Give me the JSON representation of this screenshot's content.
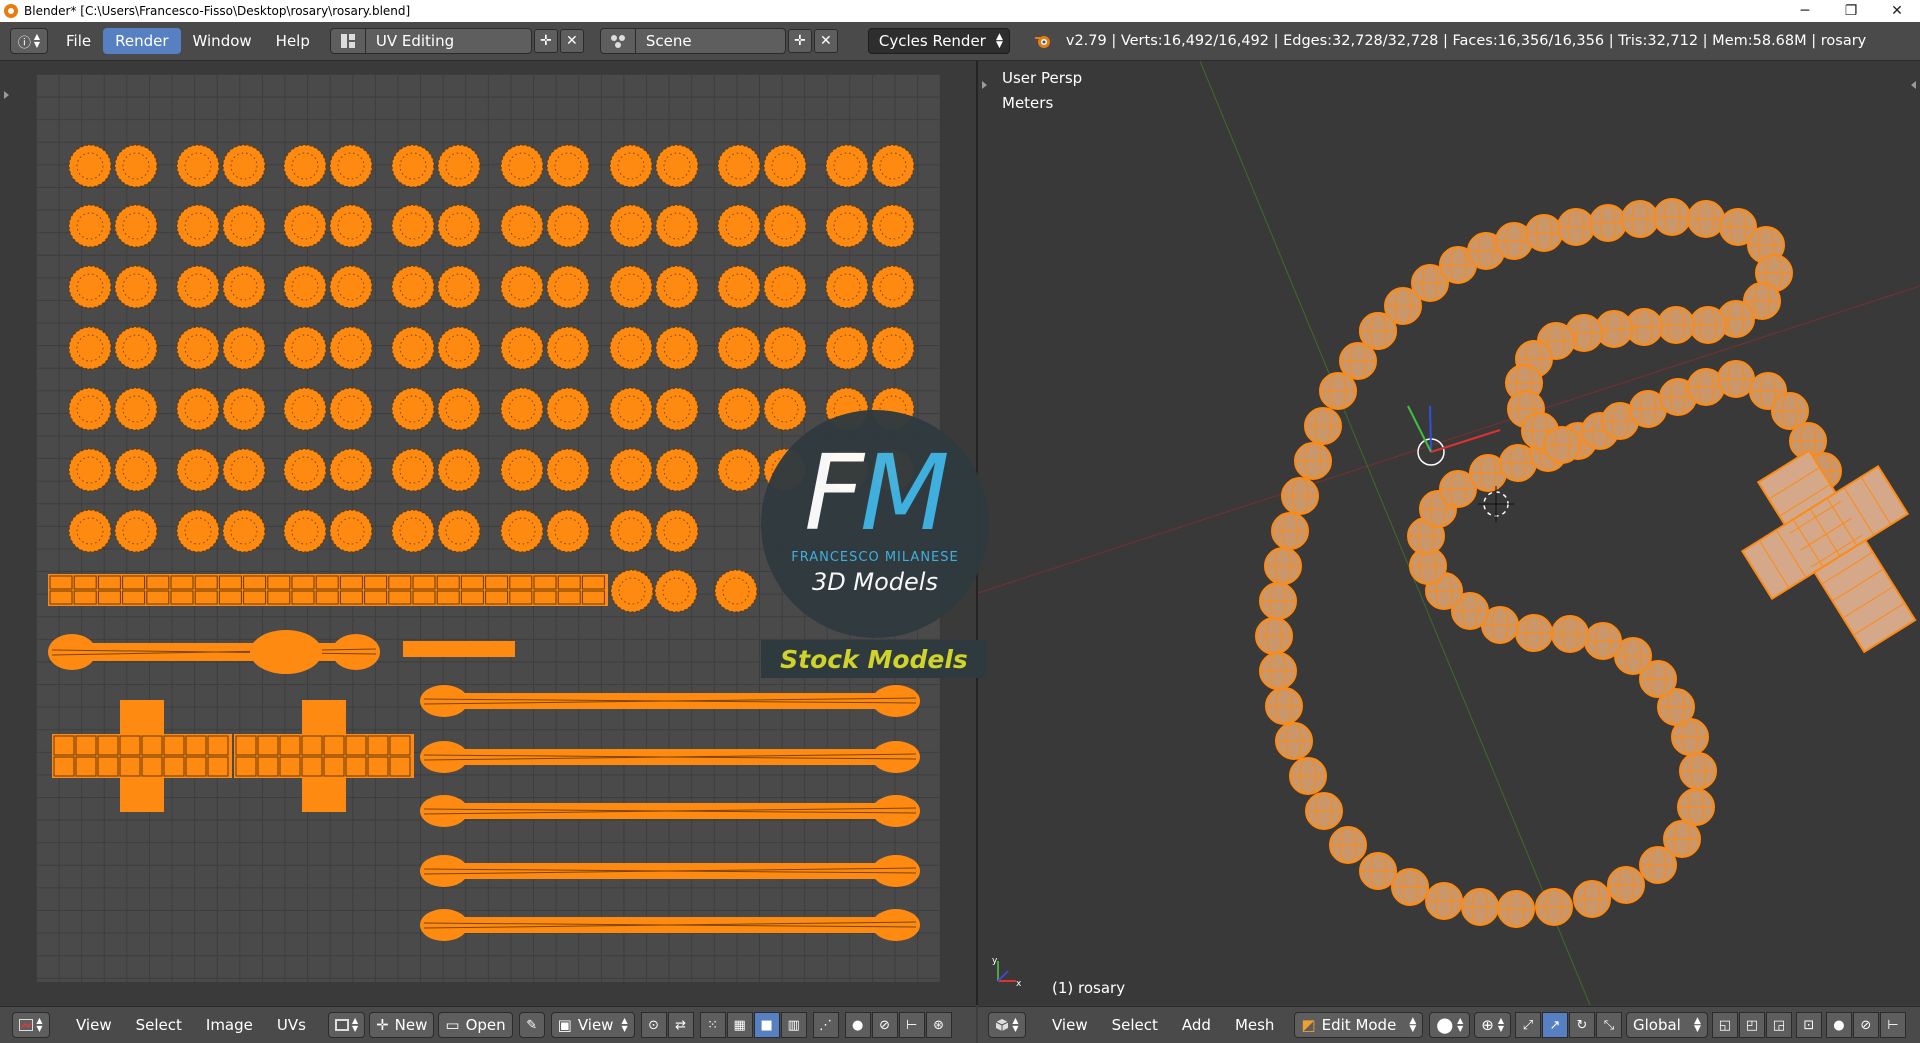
{
  "window": {
    "title": "Blender* [C:\\Users\\Francesco-Fisso\\Desktop\\rosary\\rosary.blend]",
    "minimize": "─",
    "restore": "❐",
    "close": "✕"
  },
  "info_header": {
    "menus": [
      "File",
      "Render",
      "Window",
      "Help"
    ],
    "active_menu": "Render",
    "screen_layout": "UV Editing",
    "scene": "Scene",
    "render_engine": "Cycles Render",
    "stats": "v2.79 | Verts:16,492/16,492 | Edges:32,728/32,728 | Faces:16,356/16,356 | Tris:32,712 | Mem:58.68M | rosary"
  },
  "uv_editor": {
    "menus": [
      "View",
      "Select",
      "Image",
      "UVs"
    ],
    "new_label": "New",
    "open_label": "Open",
    "view_label": "View"
  },
  "viewport": {
    "perspective": "User Persp",
    "units": "Meters",
    "object_label": "(1) rosary",
    "menus": [
      "View",
      "Select",
      "Add",
      "Mesh"
    ],
    "mode": "Edit Mode",
    "orientation": "Global"
  },
  "watermark": {
    "letter_f": "F",
    "letter_m": "M",
    "name": "FRANCESCO MILANESE",
    "subtitle": "3D Models",
    "banner": "Stock Models"
  },
  "colors": {
    "uv_orange": "#ff8a12",
    "accent_blue": "#5680c2",
    "logo_blue": "#3fb4e5",
    "banner_yellow": "#cfd32a"
  }
}
